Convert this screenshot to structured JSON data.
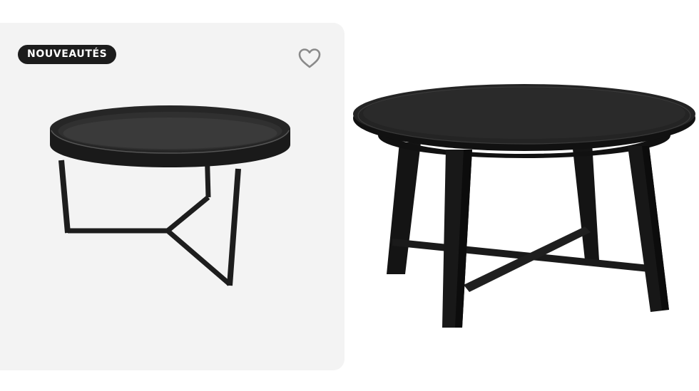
{
  "card": {
    "badge_label": "NOUVEAUTÉS",
    "favorite_icon": "heart-outline-icon",
    "product_image": "black-round-tray-coffee-table"
  },
  "second_product": {
    "product_image": "black-round-wooden-coffee-table"
  },
  "colors": {
    "card_bg": "#f3f3f3",
    "badge_bg": "#1c1c1c",
    "badge_text": "#ffffff",
    "heart_stroke": "#8a8a8a",
    "table_black": "#1a1a1a"
  }
}
